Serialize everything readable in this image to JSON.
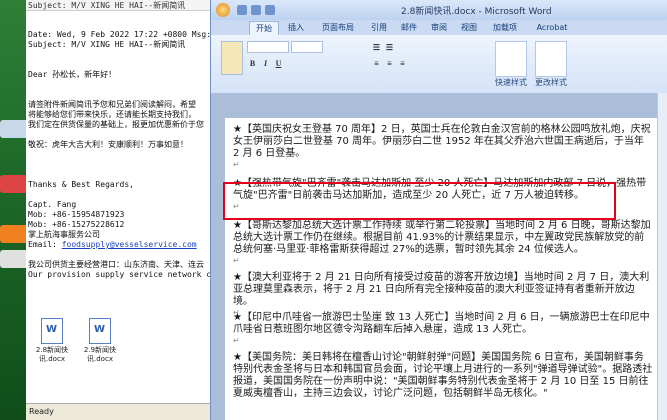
{
  "email": {
    "header_subject": "Subject: M/V XING HE HAI--新闻简讯",
    "date_line": "Date: Wed, 9 Feb 2022 17:22 +0800 Msg: A",
    "subject_line": "Subject: M/V XING HE HAI--新闻简讯",
    "greeting": "Dear 孙松长，新年好！",
    "lines": [
      "请签附件新闻简讯予您和兄弟们阅读解闷，希望",
      "将能够给您们带来快乐，还请能长期支持我们，",
      "我们定在供货保量的基础上，报更加优惠新价于您"
    ],
    "blessing": "敬祝：虎年大吉大利！安康顺利！万事如意！",
    "sign_lines": [
      "Thanks & Best Regards,",
      "Capt. Fang",
      "Mob: +86-15954871923",
      "Mob: +86-15275228612",
      "掌上航海事服务公司"
    ],
    "email_label": "Email:",
    "email_addr": "foodsupply@vesselservice.com",
    "footer_lines": [
      "我公司供货主要经营港口：山东济南、天津、连云",
      "Our provision supply service network co"
    ],
    "attachments": [
      "2.8新闻快讯.docx",
      "2.9新闻快讯.docx"
    ],
    "status": "Ready"
  },
  "word": {
    "title": "2.8新闻快讯.docx - Microsoft Word",
    "tabs": [
      "开始",
      "插入",
      "页面布局",
      "引用",
      "邮件",
      "审阅",
      "视图",
      "加载项",
      "Acrobat"
    ],
    "ribbon_labels": [
      "快速样式",
      "更改样式"
    ],
    "paragraphs": [
      "★【英国庆祝女王登基 70 周年】2 日，英国士兵在伦敦白金汉宫前的格林公园鸣放礼炮，庆祝女王伊丽莎白二世登基 70 周年。伊丽莎白二世 1952 年在其父乔治六世国王病逝后，于当年 2 月 6 日登基。",
      "★【强热带气旋\"巴齐雷\"袭击马达加斯加 至少 20 人死亡】马达加斯加内政部 7 日说，强热带气旋\"巴齐雷\"日前袭击马达加斯加，造成至少 20 人死亡，近 7 万人被迫转移。",
      "★【哥斯达黎加总统大选计票工作持续 或举行第二轮投票】当地时间 2 月 6 日晚，哥斯达黎加总统大选计票工作仍在继续。根据目前 41.93%的计票结果显示，中左翼政党民族解放党的前总统何塞·马里亚·菲格雷斯获得超过 27%的选票，暂时领先其余 24 位候选人。",
      "★【澳大利亚将于 2 月 21 日向所有接受过疫苗的游客开放边境】当地时间 2 月 7 日，澳大利亚总理莫里森表示，将于 2 月 21 日向所有完全接种疫苗的澳大利亚签证持有者重新开放边境。",
      "★【印尼中爪哇省一旅游巴士坠崖 致 13 人死亡】当地时间 2 月 6 日，一辆旅游巴士在印尼中爪哇省日惹班图尔地区德令沟路翻车后掉入悬崖，造成 13 人死亡。",
      "★【美国务院：美日韩将在檀香山讨论\"朝鲜射弹\"问题】美国国务院 6 日宣布，美国朝鲜事务特别代表金圣将与日本和韩国官员会面，讨论平壤上月进行的一系列\"弹道导弹试验\"。据路透社报道，美国国务院在一份声明中说：\"美国朝鲜事务特别代表金圣将于 2 月 10 日至 15 日前往夏威夷檀香山，主持三边会议，讨论广泛问题，包括朝鲜半岛无核化。\""
    ],
    "pilcrow": "↵"
  }
}
